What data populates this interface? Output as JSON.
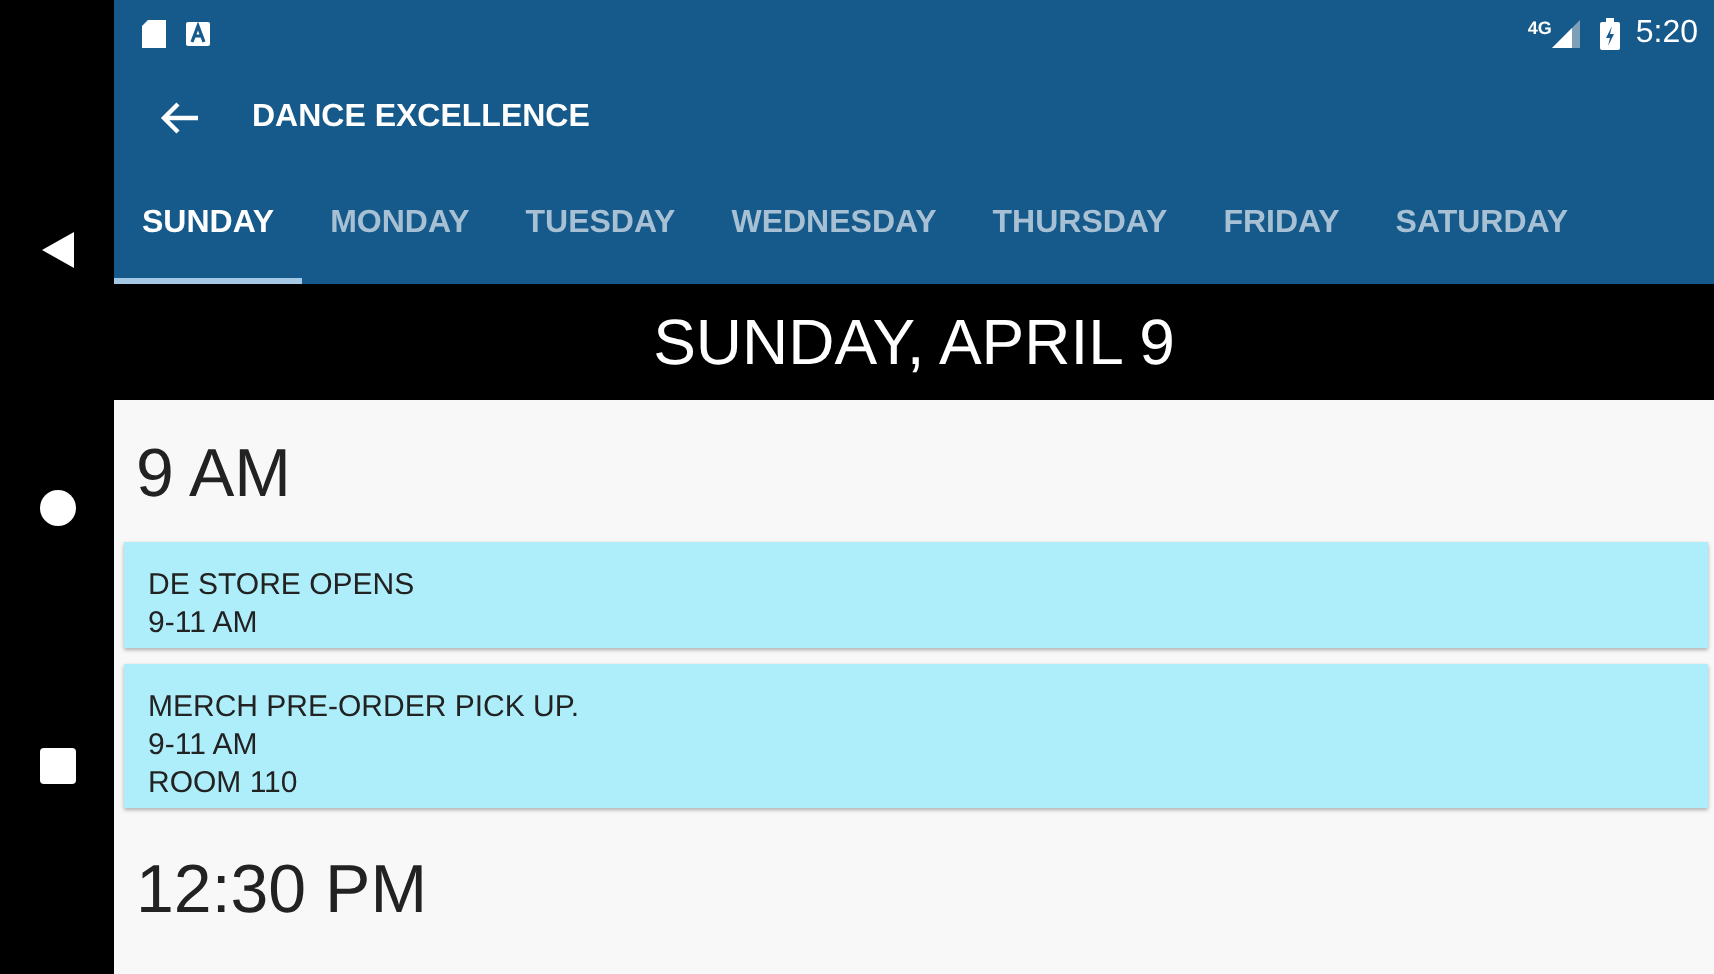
{
  "status_bar": {
    "network": "4G",
    "time": "5:20"
  },
  "toolbar": {
    "title": "DANCE EXCELLENCE"
  },
  "tabs": [
    {
      "label": "SUNDAY",
      "selected": true
    },
    {
      "label": "MONDAY",
      "selected": false
    },
    {
      "label": "TUESDAY",
      "selected": false
    },
    {
      "label": "WEDNESDAY",
      "selected": false
    },
    {
      "label": "THURSDAY",
      "selected": false
    },
    {
      "label": "FRIDAY",
      "selected": false
    },
    {
      "label": "SATURDAY",
      "selected": false
    }
  ],
  "date_header": "SUNDAY, APRIL 9",
  "time_groups": [
    {
      "time": "9 AM",
      "events": [
        {
          "lines": [
            "DE STORE OPENS",
            "9-11 AM"
          ]
        },
        {
          "lines": [
            "MERCH PRE-ORDER PICK UP.",
            "9-11 AM",
            "ROOM 110"
          ]
        }
      ]
    },
    {
      "time": "12:30 PM"
    }
  ]
}
